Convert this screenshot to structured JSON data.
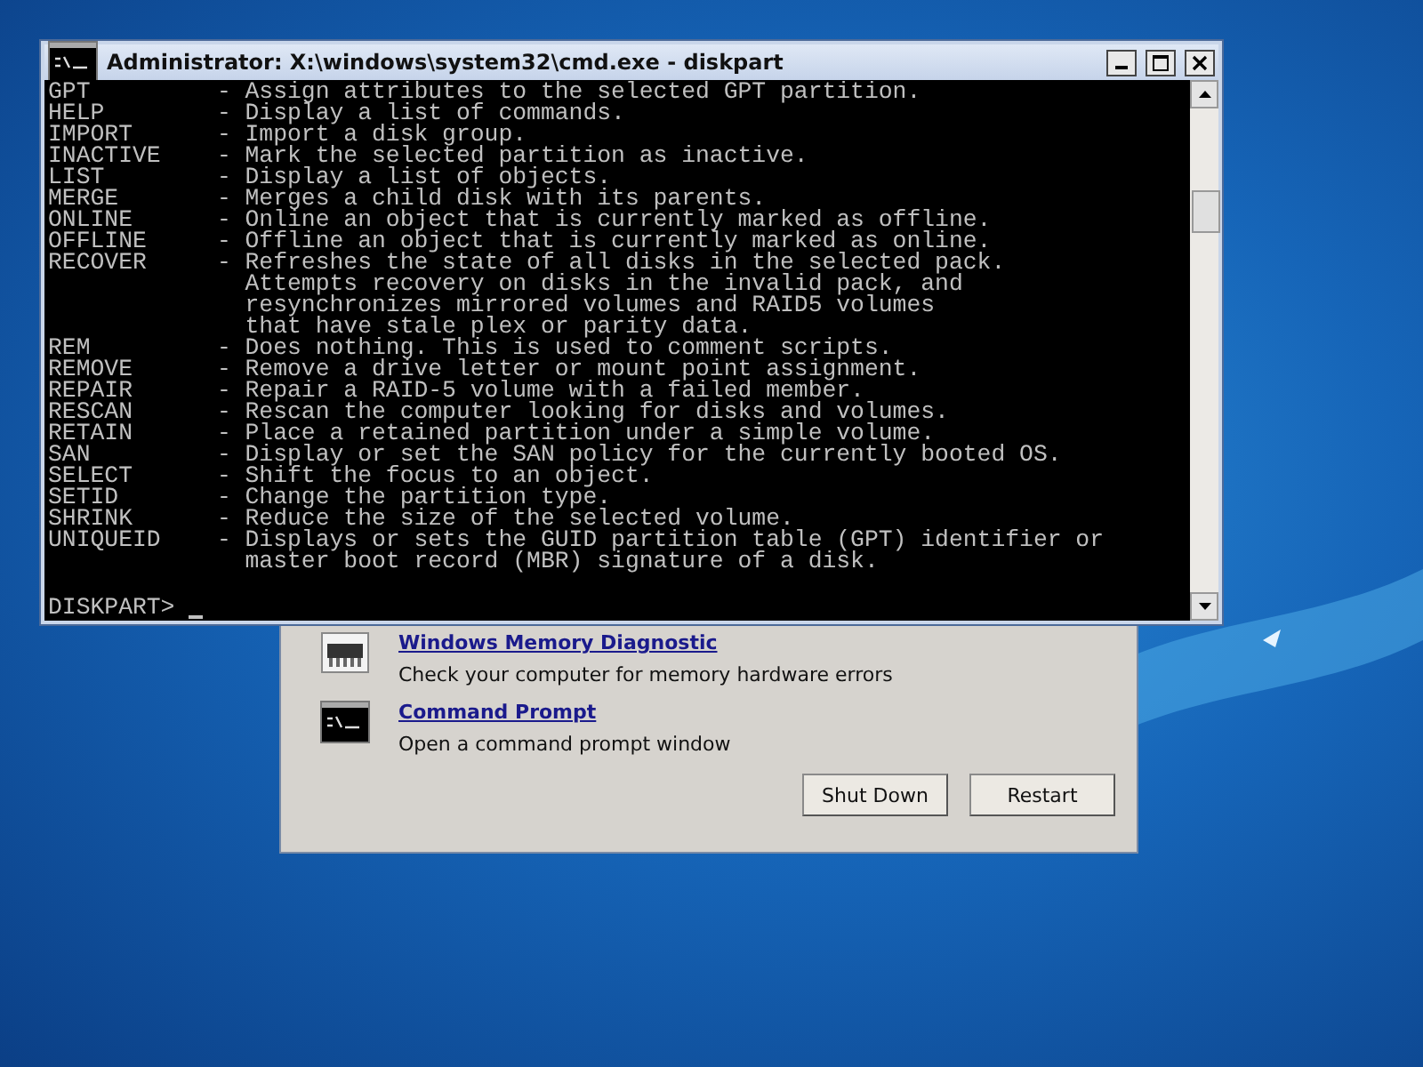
{
  "recovery_dialog": {
    "tools": [
      {
        "kind": "memory",
        "title": "Windows Memory Diagnostic",
        "description": "Check your computer for memory hardware errors"
      },
      {
        "kind": "console",
        "title": "Command Prompt",
        "description": "Open a command prompt window"
      }
    ],
    "buttons": [
      "Shut Down",
      "Restart"
    ]
  },
  "console_window": {
    "title": "Administrator: X:\\windows\\system32\\cmd.exe - diskpart",
    "commands": [
      {
        "name": "GPT",
        "separator": "-",
        "description": [
          "Assign attributes to the selected GPT partition."
        ]
      },
      {
        "name": "HELP",
        "separator": "-",
        "description": [
          "Display a list of commands."
        ]
      },
      {
        "name": "IMPORT",
        "separator": "-",
        "description": [
          "Import a disk group."
        ]
      },
      {
        "name": "INACTIVE",
        "separator": "-",
        "description": [
          "Mark the selected partition as inactive."
        ]
      },
      {
        "name": "LIST",
        "separator": "-",
        "description": [
          "Display a list of objects."
        ]
      },
      {
        "name": "MERGE",
        "separator": "-",
        "description": [
          "Merges a child disk with its parents."
        ]
      },
      {
        "name": "ONLINE",
        "separator": "-",
        "description": [
          "Online an object that is currently marked as offline."
        ]
      },
      {
        "name": "OFFLINE",
        "separator": "-",
        "description": [
          "Offline an object that is currently marked as online."
        ]
      },
      {
        "name": "RECOVER",
        "separator": "-",
        "description": [
          "Refreshes the state of all disks in the selected pack.",
          "Attempts recovery on disks in the invalid pack, and",
          "resynchronizes mirrored volumes and RAID5 volumes",
          "that have stale plex or parity data."
        ]
      },
      {
        "name": "REM",
        "separator": "-",
        "description": [
          "Does nothing. This is used to comment scripts."
        ]
      },
      {
        "name": "REMOVE",
        "separator": "-",
        "description": [
          "Remove a drive letter or mount point assignment."
        ]
      },
      {
        "name": "REPAIR",
        "separator": "-",
        "description": [
          "Repair a RAID-5 volume with a failed member."
        ]
      },
      {
        "name": "RESCAN",
        "separator": "-",
        "description": [
          "Rescan the computer looking for disks and volumes."
        ]
      },
      {
        "name": "RETAIN",
        "separator": "-",
        "description": [
          "Place a retained partition under a simple volume."
        ]
      },
      {
        "name": "SAN",
        "separator": "-",
        "description": [
          "Display or set the SAN policy for the currently booted OS."
        ]
      },
      {
        "name": "SELECT",
        "separator": "-",
        "description": [
          "Shift the focus to an object."
        ]
      },
      {
        "name": "SETID",
        "separator": "-",
        "description": [
          "Change the partition type."
        ]
      },
      {
        "name": "SHRINK",
        "separator": "-",
        "description": [
          "Reduce the size of the selected volume."
        ]
      },
      {
        "name": "UNIQUEID",
        "separator": "-",
        "description": [
          "Displays or sets the GUID partition table (GPT) identifier or",
          "master boot record (MBR) signature of a disk."
        ]
      }
    ],
    "prompt": "DISKPART>"
  }
}
